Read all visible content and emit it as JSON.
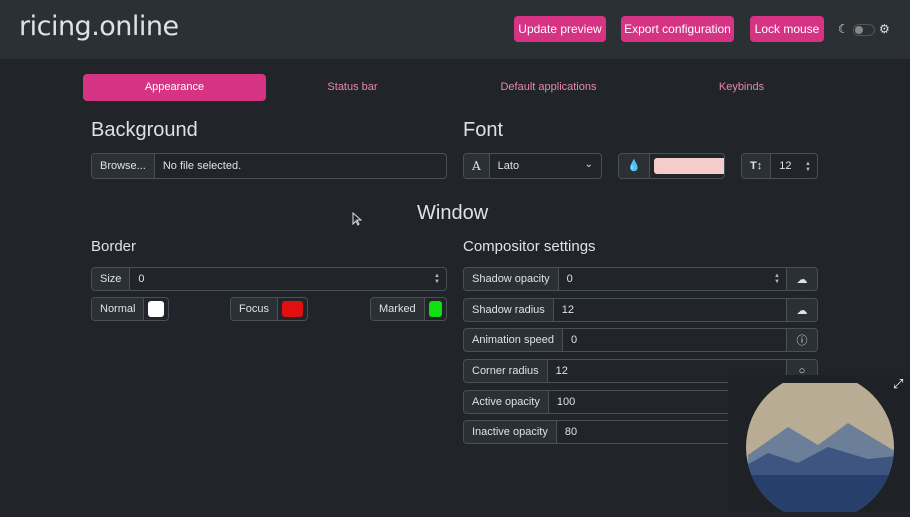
{
  "app": {
    "title": "ricing.online"
  },
  "header": {
    "update_preview": "Update preview",
    "export_configuration": "Export configuration",
    "lock_mouse": "Lock mouse"
  },
  "tabs": [
    {
      "label": "Appearance",
      "active": true
    },
    {
      "label": "Status bar",
      "active": false
    },
    {
      "label": "Default applications",
      "active": false
    },
    {
      "label": "Keybinds",
      "active": false
    }
  ],
  "background": {
    "title": "Background",
    "browse_label": "Browse...",
    "file_status": "No file selected."
  },
  "font": {
    "title": "Font",
    "family": "Lato",
    "color": "#f4cccc",
    "size": "12"
  },
  "window": {
    "title": "Window"
  },
  "border": {
    "title": "Border",
    "size_label": "Size",
    "size_value": "0",
    "normal_label": "Normal",
    "normal_color": "#ffffff",
    "focus_label": "Focus",
    "focus_color": "#e01010",
    "marked_label": "Marked",
    "marked_color": "#10e010"
  },
  "compositor": {
    "title": "Compositor settings",
    "rows": [
      {
        "label": "Shadow opacity",
        "value": "0",
        "icon": "shadow-icon"
      },
      {
        "label": "Shadow radius",
        "value": "12",
        "icon": "shadow-icon"
      },
      {
        "label": "Animation speed",
        "value": "0",
        "icon": "info-icon"
      },
      {
        "label": "Corner radius",
        "value": "12",
        "icon": "circle-icon"
      },
      {
        "label": "Active opacity",
        "value": "100",
        "icon": "eye-slash-icon"
      },
      {
        "label": "Inactive opacity",
        "value": "80",
        "icon": "eye-slash-icon"
      }
    ]
  },
  "colors": {
    "accent": "#d63384",
    "bg": "#212529",
    "panel": "#2b3035"
  }
}
